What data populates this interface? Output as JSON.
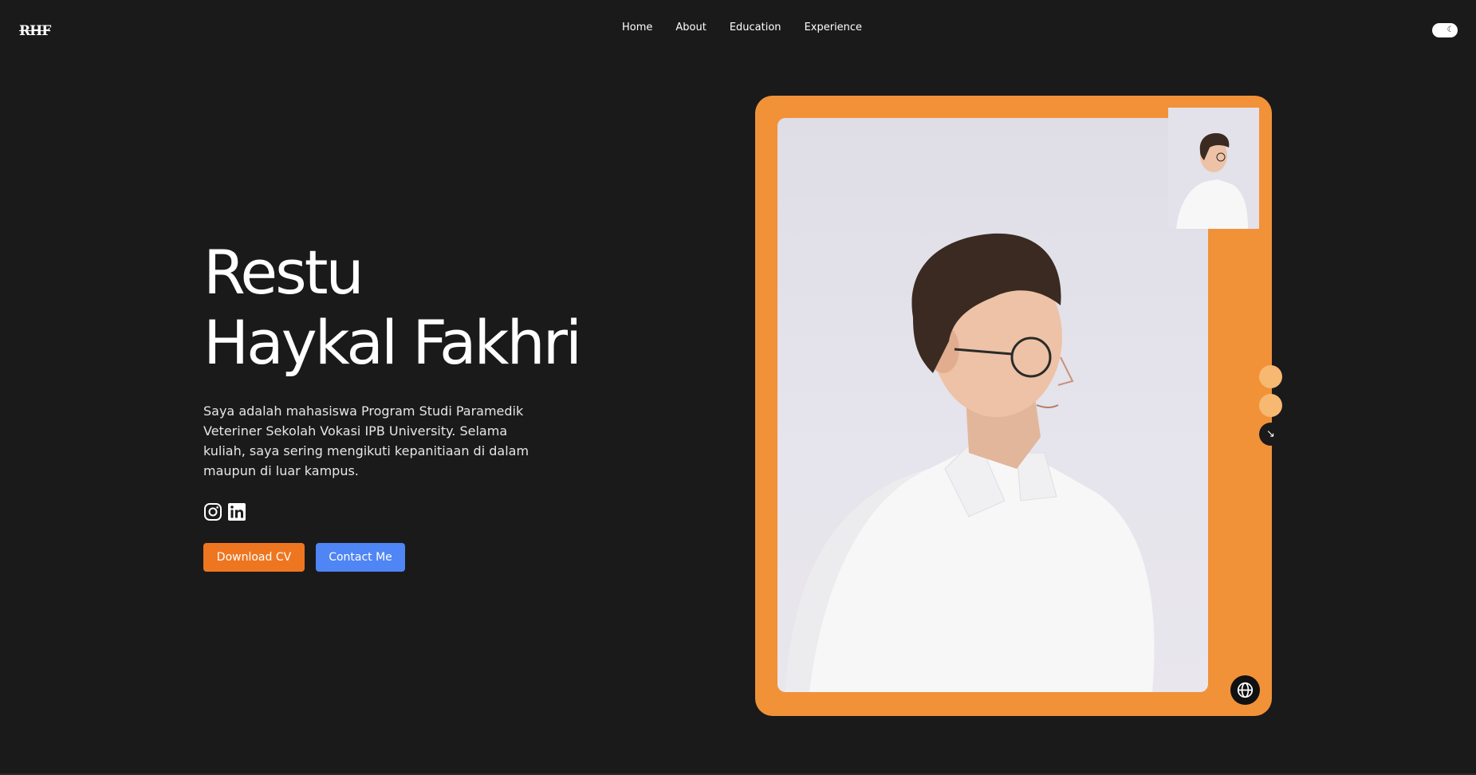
{
  "header": {
    "logo": "RHF",
    "nav": [
      "Home",
      "About",
      "Education",
      "Experience"
    ],
    "theme_toggle_icon": "moon-icon"
  },
  "hero": {
    "name_line1": "Restu",
    "name_line2": "Haykal Fakhri",
    "bio": "Saya adalah mahasiswa Program Studi Paramedik Veteriner Sekolah Vokasi IPB University. Selama kuliah, saya sering mengikuti kepanitiaan di dalam maupun di luar kampus.",
    "socials": [
      "instagram-icon",
      "linkedin-icon"
    ],
    "download_cv_label": "Download CV",
    "contact_label": "Contact Me"
  },
  "photo_card": {
    "accent": "#f19239",
    "arrow_icon": "arrow-down-right-icon",
    "globe_icon": "globe-icon"
  },
  "colors": {
    "background": "#1b1a1b",
    "download_button": "#ee7620",
    "contact_button": "#4f85f4"
  }
}
